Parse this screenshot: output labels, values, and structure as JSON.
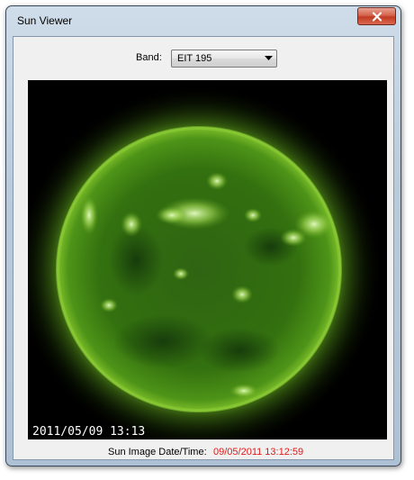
{
  "window": {
    "title": "Sun Viewer"
  },
  "band": {
    "label": "Band:",
    "selected": "EIT 195"
  },
  "image": {
    "timestamp": "2011/05/09 13:13"
  },
  "date": {
    "label": "Sun Image Date/Time:",
    "value": "09/05/2011 13:12:59"
  },
  "icons": {
    "close": "close-icon",
    "dropdown": "dropdown-arrow-icon"
  },
  "colors": {
    "date_value": "#e21a1a",
    "sun_green": "#4f8c17"
  }
}
